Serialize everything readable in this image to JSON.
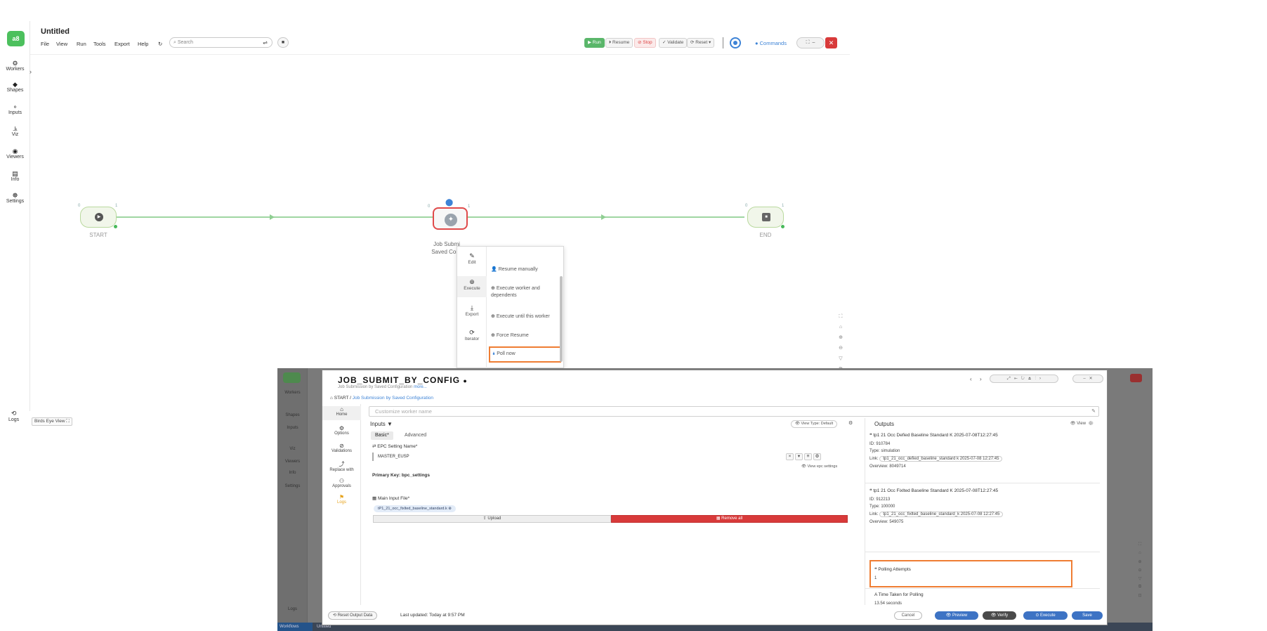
{
  "app": {
    "logo_text": "a8",
    "title": "Untitled",
    "menu": [
      "File",
      "View",
      "Run",
      "Tools",
      "Export",
      "Help"
    ],
    "search_placeholder": "Search",
    "toolbar": {
      "run": "▶ Run",
      "resume": "⏵ Resume",
      "stop": "⊘ Stop",
      "validate": "✓ Validate",
      "reset": "⟳ Reset ▾",
      "commands": "Commands"
    }
  },
  "sidebar": {
    "items": [
      {
        "icon": "⚙",
        "label": "Workers"
      },
      {
        "icon": "◆",
        "label": "Shapes"
      },
      {
        "icon": "⚬",
        "label": "Inputs"
      },
      {
        "icon": "⫡",
        "label": "Viz"
      },
      {
        "icon": "◉",
        "label": "Viewers"
      },
      {
        "icon": "▤",
        "label": "Info"
      },
      {
        "icon": "☸",
        "label": "Settings"
      }
    ],
    "logs": "Logs",
    "birds_eye": "Birds Eye View ⛶"
  },
  "canvas": {
    "start_label": "START",
    "end_label": "END",
    "job_label_line1": "Job Submi",
    "job_label_line2": "Saved Confi",
    "port_left": "0",
    "port_right": "1"
  },
  "context_menu": {
    "categories": [
      {
        "icon": "✎",
        "label": "Edit"
      },
      {
        "icon": "⊕",
        "label": "Execute"
      },
      {
        "icon": "⤓",
        "label": "Export"
      },
      {
        "icon": "⟳",
        "label": "Iterator"
      }
    ],
    "options": [
      {
        "icon": "👤",
        "label": "Resume manually"
      },
      {
        "icon": "⊕",
        "label": "Execute worker and dependents"
      },
      {
        "icon": "⊕",
        "label": "Execute until this worker"
      },
      {
        "icon": "⊕",
        "label": "Force Resume"
      },
      {
        "icon": "🌢",
        "label": "Poll now"
      }
    ]
  },
  "modal": {
    "title": "JOB_SUBMIT_BY_CONFIG",
    "subtitle": "Job Submission by Saved Configuration",
    "subtitle_link": "more...",
    "breadcrumb_home": "START",
    "breadcrumb_link": "Job Submission by Saved Configuration",
    "side": [
      {
        "icon": "⌂",
        "label": "Home"
      },
      {
        "icon": "⚙",
        "label": "Options"
      },
      {
        "icon": "⊘",
        "label": "Validations"
      },
      {
        "icon": "⤴",
        "label": "Replace with"
      },
      {
        "icon": "⚇",
        "label": "Approvals"
      },
      {
        "icon": "⚑",
        "label": "Logs"
      }
    ],
    "name_placeholder": "Customize worker name",
    "inputs_header": "Inputs ▼",
    "view_type": "👁 View Type: Default",
    "tabs": [
      "Basic*",
      "Advanced"
    ],
    "fld1_label": "⇄ EPC Setting Name*",
    "fld1_value": "MASTER_EUSP",
    "fld1_view": "👁 View epc settings",
    "primary_key": "Primary Key: bpc_settings",
    "fld2_label": "▦ Main Input File*",
    "fld2_chip": "tP1_21_occ_fixlted_baseline_standard.k",
    "upload_btn": "⇪ Upload",
    "remove_btn": "▦ Remove all",
    "outputs_header": "Outputs",
    "outputs_view": "👁 View",
    "out1_title": "tp1 21 Occ Defied Baseline Standard K 2025-07-08T12:27:45",
    "out1_id": "ID: 910784",
    "out1_type": "Type: simulation",
    "out1_link": "tp1_21_occ_defied_baseline_standard k 2025-07-08 12:27:45",
    "out1_overview": "Overview: 8049714",
    "out2_title": "tp1 21 Occ Fixlted Baseline Standard K 2025-07-08T12:27:45",
    "out2_id": "ID: 912213",
    "out2_type": "Type: 100000",
    "out2_link": "tp1_21_occ_fixlted_baseline_standard_k 2025-07-08 12:27:45",
    "out2_overview": "Overview: 549075",
    "out3_title": "Polling Attempts",
    "out3_value": "1",
    "out4_title": "Time Taken for Polling",
    "out4_value": "13.54 seconds",
    "reset_btn": "⟲ Reset Output Data",
    "last_updated": "Last updated: Today at 9:57 PM",
    "cancel": "Cancel",
    "preview": "👁 Preview",
    "verify": "👁 Verify",
    "execute": "⊙ Execute",
    "save": "Save"
  },
  "background": {
    "bottom_tab_1": "Workflows",
    "bottom_tab_2": "Untitled"
  }
}
